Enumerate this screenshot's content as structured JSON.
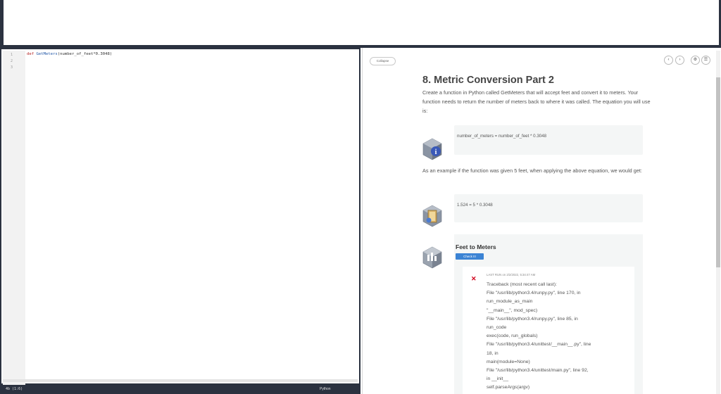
{
  "editor": {
    "line_numbers": [
      "1",
      "2",
      "3"
    ],
    "code": {
      "keyword": "def",
      "function_name": "GetMeters",
      "rest": "(number_of_feet*0.3048)"
    },
    "status_left": "4b (1:6)",
    "status_right": "Python"
  },
  "content": {
    "collapse_label": "Collapse",
    "nav": {
      "prev": "‹",
      "next": "›",
      "settings": "⚙",
      "menu": "☰"
    },
    "title": "8. Metric Conversion Part 2",
    "intro": "Create a function in Python called GetMeters that will accept feet and convert it to meters. Your function needs to return the number of meters back to where it was called. The equation you will use is:",
    "equation": "number_of_meters = number_of_feet * 0.3048",
    "example_text": "As an example if the function was given 5 feet, when applying the above equation, we would get:",
    "example_result": "1.524 = 5 * 0.3048",
    "feet_title": "Feet to Meters",
    "check_label": "Check It!",
    "last_run": "LAST RUN on 2/2/2022, 5:34:47 AM",
    "traceback": [
      "Traceback (most recent call last):",
      "  File \"/usr/lib/python3.4/runpy.py\", line 170, in",
      "  run_module_as_main",
      "    \"__main__\", mod_spec)",
      "  File \"/usr/lib/python3.4/runpy.py\", line 85, in",
      "  run_code",
      "    exec(code, run_globals)",
      "  File \"/usr/lib/python3.4/unittest/__main__.py\", line",
      "  18, in",
      "    main(module=None)",
      "  File \"/usr/lib/python3.4/unittest/main.py\", line 92,",
      "  in __init__",
      "    self.parseArgs(argv)"
    ]
  },
  "colors": {
    "frame": "#2b3240",
    "accent": "#3b83d4",
    "error": "#d0021b"
  }
}
